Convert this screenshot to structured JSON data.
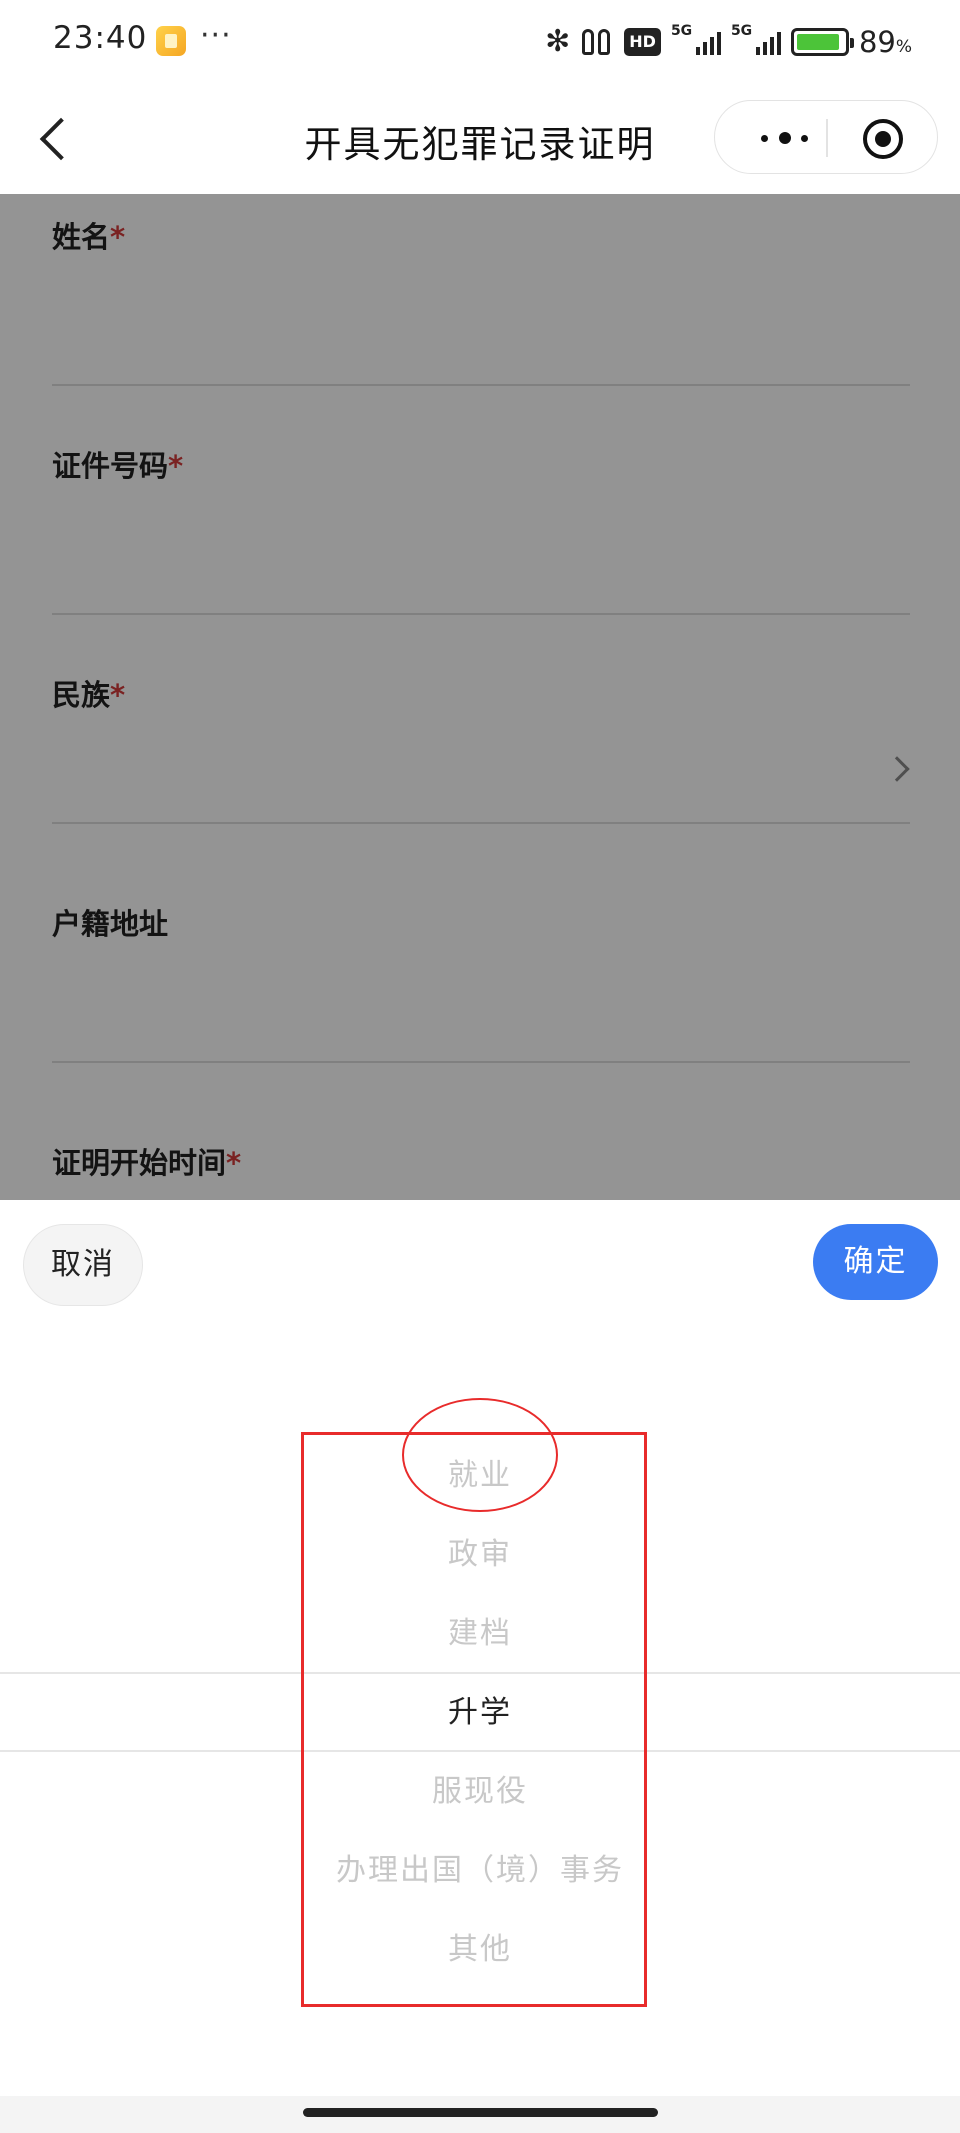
{
  "status_bar": {
    "time": "23:40",
    "dots": "···",
    "bluetooth_glyph": "✻",
    "hd_badge": "HD",
    "sim1_label": "5G",
    "sim2_label": "5G",
    "battery_percent": "89",
    "battery_unit": "%",
    "battery_level": 0.89,
    "battery_color": "#4cc439"
  },
  "nav": {
    "title": "开具无犯罪记录证明"
  },
  "form": {
    "fields": [
      {
        "label": "姓名",
        "required": "*"
      },
      {
        "label": "证件号码",
        "required": "*"
      },
      {
        "label": "民族",
        "required": "*"
      },
      {
        "label": "户籍地址",
        "required": ""
      },
      {
        "label": "证明开始时间",
        "required": "*"
      }
    ]
  },
  "picker": {
    "cancel_label": "取消",
    "confirm_label": "确定",
    "confirm_color": "#3b7cf2",
    "options": [
      "就业",
      "政审",
      "建档",
      "升学",
      "服现役",
      "办理出国（境）事务",
      "其他"
    ],
    "selected": "升学"
  },
  "annotations": {
    "color": "#e82b2b"
  }
}
